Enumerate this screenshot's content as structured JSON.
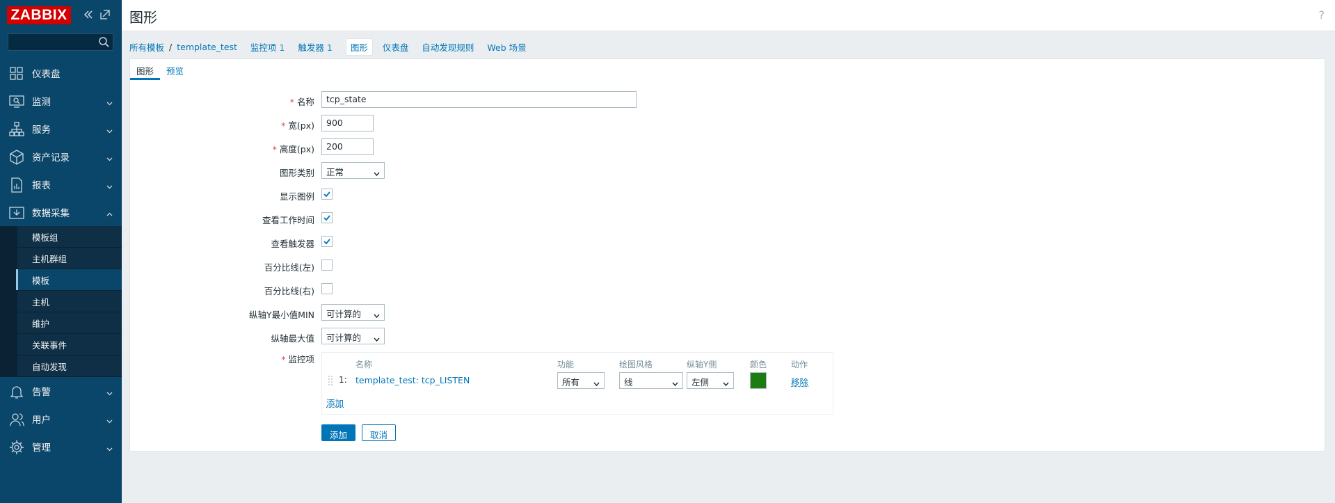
{
  "app": {
    "logo_text": "ZABBIX",
    "page_title": "图形",
    "help": "?"
  },
  "sidebar": {
    "search_placeholder": "",
    "menu": [
      {
        "label": "仪表盘",
        "icon": "dashboard-icon"
      },
      {
        "label": "监测",
        "icon": "monitoring-icon"
      },
      {
        "label": "服务",
        "icon": "services-icon"
      },
      {
        "label": "资产记录",
        "icon": "inventory-icon"
      },
      {
        "label": "报表",
        "icon": "reports-icon"
      },
      {
        "label": "数据采集",
        "icon": "data-collection-icon"
      }
    ],
    "submenu": [
      {
        "label": "模板组"
      },
      {
        "label": "主机群组"
      },
      {
        "label": "模板"
      },
      {
        "label": "主机"
      },
      {
        "label": "维护"
      },
      {
        "label": "关联事件"
      },
      {
        "label": "自动发现"
      }
    ],
    "menu_bottom": [
      {
        "label": "告警",
        "icon": "alerts-icon"
      },
      {
        "label": "用户",
        "icon": "users-icon"
      },
      {
        "label": "管理",
        "icon": "administration-icon"
      }
    ]
  },
  "breadcrumb": {
    "all_templates": "所有模板",
    "separator": "/",
    "template": "template_test",
    "tabs": [
      {
        "label": "监控项",
        "count": "1"
      },
      {
        "label": "触发器",
        "count": "1"
      },
      {
        "label": "图形",
        "count": ""
      },
      {
        "label": "仪表盘",
        "count": ""
      },
      {
        "label": "自动发现规则",
        "count": ""
      },
      {
        "label": "Web 场景",
        "count": ""
      }
    ]
  },
  "form_tabs": {
    "graph": "图形",
    "preview": "预览"
  },
  "form": {
    "name_label": "名称",
    "name_value": "tcp_state",
    "width_label": "宽(px)",
    "width_value": "900",
    "height_label": "高度(px)",
    "height_value": "200",
    "graph_type_label": "图形类别",
    "graph_type_value": "正常",
    "show_legend_label": "显示图例",
    "show_legend": true,
    "work_period_label": "查看工作时间",
    "work_period": true,
    "triggers_label": "查看触发器",
    "triggers": true,
    "percent_left_label": "百分比线(左)",
    "percent_left": false,
    "percent_right_label": "百分比线(右)",
    "percent_right": false,
    "ymin_label": "纵轴Y最小值MIN",
    "ymin_value": "可计算的",
    "ymax_label": "纵轴最大值",
    "ymax_value": "可计算的",
    "items_label": "监控项"
  },
  "items_table": {
    "headers": {
      "name": "名称",
      "function": "功能",
      "draw_style": "绘图风格",
      "y_side": "纵轴Y侧",
      "color": "颜色",
      "action": "动作"
    },
    "rows": [
      {
        "index": "1:",
        "name": "template_test: tcp_LISTEN",
        "function": "所有",
        "draw_style": "线",
        "y_side": "左侧",
        "color": "#1a7c11",
        "action": "移除"
      }
    ],
    "add_link": "添加"
  },
  "buttons": {
    "add": "添加",
    "cancel": "取消"
  }
}
